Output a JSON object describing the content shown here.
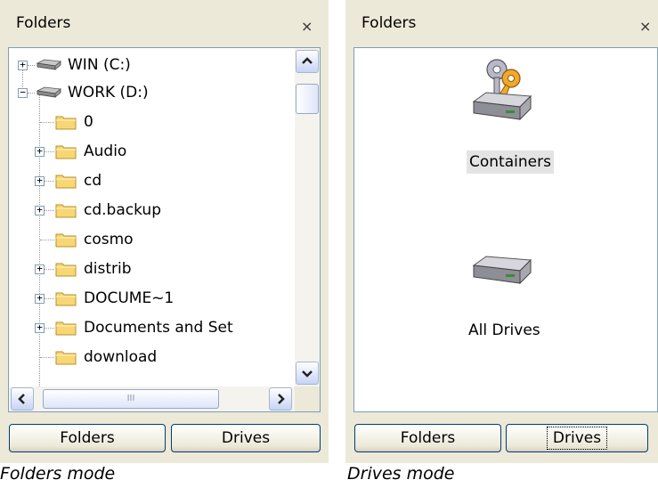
{
  "folders_pane": {
    "title": "Folders",
    "close": "×",
    "tree": [
      {
        "label": "WIN (C:)"
      },
      {
        "label": "WORK (D:)"
      },
      {
        "label": "0"
      },
      {
        "label": "Audio"
      },
      {
        "label": "cd"
      },
      {
        "label": "cd.backup"
      },
      {
        "label": "cosmo"
      },
      {
        "label": "distrib"
      },
      {
        "label": "DOCUME~1"
      },
      {
        "label": "Documents and Set"
      },
      {
        "label": "download"
      }
    ],
    "hscroll_grip": "III",
    "buttons": {
      "folders": "Folders",
      "drives": "Drives"
    },
    "caption": "Folders mode"
  },
  "drives_pane": {
    "title": "Folders",
    "close": "×",
    "items": [
      {
        "label": "Containers"
      },
      {
        "label": "All Drives"
      }
    ],
    "buttons": {
      "folders": "Folders",
      "drives": "Drives"
    },
    "caption": "Drives mode"
  },
  "colors": {
    "pane_bg": "#ece9d8",
    "border": "#7f9db9",
    "folder": "#f7d774",
    "key": "#f0a92a"
  }
}
